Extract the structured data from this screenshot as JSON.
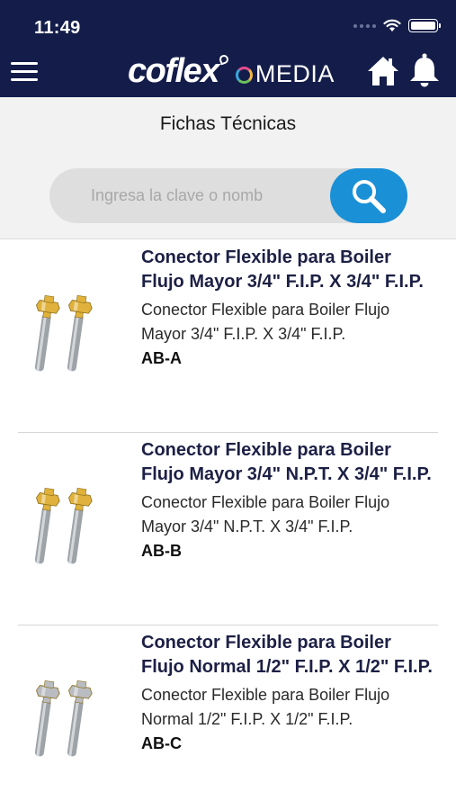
{
  "status_bar": {
    "time": "11:49"
  },
  "header": {
    "logo_brand": "coflex",
    "logo_media": "MEDIA"
  },
  "page": {
    "title": "Fichas Técnicas"
  },
  "search": {
    "placeholder": "Ingresa la clave o nomb"
  },
  "products": [
    {
      "title": "Conector Flexible para Boiler Flujo Mayor 3/4\" F.I.P. X 3/4\" F.I.P.",
      "description": "Conector Flexible para Boiler Flujo Mayor 3/4\" F.I.P. X 3/4\" F.I.P.",
      "code": "AB-A",
      "nut_color": "#e0b23c"
    },
    {
      "title": "Conector Flexible para Boiler Flujo Mayor 3/4\" N.P.T. X 3/4\" F.I.P.",
      "description": "Conector Flexible para Boiler Flujo Mayor 3/4\" N.P.T. X 3/4\" F.I.P.",
      "code": "AB-B",
      "nut_color": "#e0b23c"
    },
    {
      "title": "Conector Flexible para Boiler Flujo Normal 1/2\" F.I.P. X 1/2\" F.I.P.",
      "description": "Conector Flexible para Boiler Flujo Normal 1/2\" F.I.P. X 1/2\" F.I.P.",
      "code": "AB-C",
      "nut_color": "#b9bcc0"
    }
  ],
  "colors": {
    "header_bg": "#141d4a",
    "accent": "#1a90d6",
    "title_text": "#1d2045"
  },
  "icons": [
    "menu-icon",
    "home-icon",
    "bell-icon",
    "search-icon",
    "wifi-icon",
    "battery-icon",
    "cellular-signal-icon"
  ]
}
